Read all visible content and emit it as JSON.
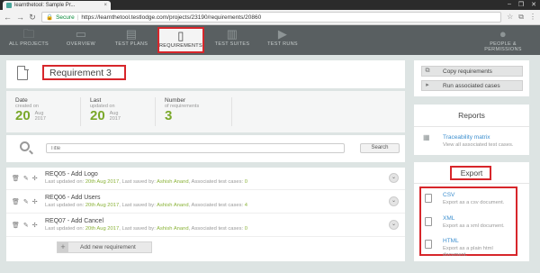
{
  "browser": {
    "tab_title": "learnthetool: Sample Pr...",
    "tab_close": "×",
    "window_controls": [
      "–",
      "❐",
      "✕"
    ],
    "back": "←",
    "forward": "→",
    "reload": "↻",
    "secure_label": "Secure",
    "url": "https://learnthetool.testlodge.com/projects/23190/requirements/20860",
    "icons": [
      "star-icon",
      "extension-icon",
      "menu-icon"
    ],
    "icon_glyphs": [
      "☆",
      "⧉",
      "⋮"
    ]
  },
  "nav": {
    "items": [
      {
        "label": "ALL PROJECTS",
        "icon": "folder-icon",
        "glyph": "🗀"
      },
      {
        "label": "OVERVIEW",
        "icon": "monitor-icon",
        "glyph": "▭"
      },
      {
        "label": "TEST PLANS",
        "icon": "clipboard-icon",
        "glyph": "▤"
      },
      {
        "label": "REQUIREMENTS",
        "icon": "document-icon",
        "glyph": "▯"
      },
      {
        "label": "TEST SUITES",
        "icon": "cabinet-icon",
        "glyph": "▥"
      },
      {
        "label": "TEST RUNS",
        "icon": "play-icon",
        "glyph": "▶"
      },
      {
        "label": "PEOPLE & PERMISSIONS",
        "icon": "person-icon",
        "glyph": "●"
      }
    ],
    "active": "REQUIREMENTS"
  },
  "requirement": {
    "title": "Requirement 3",
    "stats": {
      "date": {
        "label": "Date",
        "sub": "created on",
        "day": "20",
        "month": "Aug",
        "year": "2017"
      },
      "last": {
        "label": "Last",
        "sub": "updated on",
        "day": "20",
        "month": "Aug",
        "year": "2017"
      },
      "number": {
        "label": "Number",
        "sub": "of requirements",
        "value": "3"
      }
    }
  },
  "search": {
    "placeholder": "Title",
    "button_label": "Search"
  },
  "requirements_list": [
    {
      "code": "REQ05",
      "name": "Add Logo",
      "updated_prefix": "Last updated on: ",
      "updated_date": "20th Aug 2017",
      "saved_prefix": ", Last saved by: ",
      "saved_by": "Ashish Anand",
      "cases_prefix": ", Associated test cases: ",
      "cases": "0"
    },
    {
      "code": "REQ06",
      "name": "Add Users",
      "updated_prefix": "Last updated on: ",
      "updated_date": "20th Aug 2017",
      "saved_prefix": ", Last saved by: ",
      "saved_by": "Ashish Anand",
      "cases_prefix": ", Associated test cases: ",
      "cases": "4"
    },
    {
      "code": "REQ07",
      "name": "Add Cancel",
      "updated_prefix": "Last updated on: ",
      "updated_date": "20th Aug 2017",
      "saved_prefix": ", Last saved by: ",
      "saved_by": "Ashish Anand",
      "cases_prefix": ", Associated test cases: ",
      "cases": "0"
    }
  ],
  "row_tools": {
    "delete": "🗑",
    "edit": "✎",
    "move": "✢",
    "expand": "⌄"
  },
  "add_requirement": {
    "plus": "+",
    "label": "Add new requirement"
  },
  "actions": {
    "copy": {
      "label": "Copy requirements",
      "glyph": "⧉"
    },
    "run": {
      "label": "Run associated cases",
      "glyph": "▸"
    }
  },
  "reports": {
    "heading": "Reports",
    "items": [
      {
        "title": "Traceability matrix",
        "desc": "View all associated test cases.",
        "glyph": "▦"
      }
    ]
  },
  "export": {
    "heading": "Export",
    "items": [
      {
        "title": "CSV",
        "desc": "Export as a csv document."
      },
      {
        "title": "XML",
        "desc": "Export as a xml document."
      },
      {
        "title": "HTML",
        "desc_line1": "Export as a plain html",
        "desc_line2": "document."
      }
    ]
  },
  "colors": {
    "accent_red": "#d7262b",
    "green": "#7aa82a",
    "link_blue": "#3d8fcf",
    "nav_bg": "#595f61"
  }
}
